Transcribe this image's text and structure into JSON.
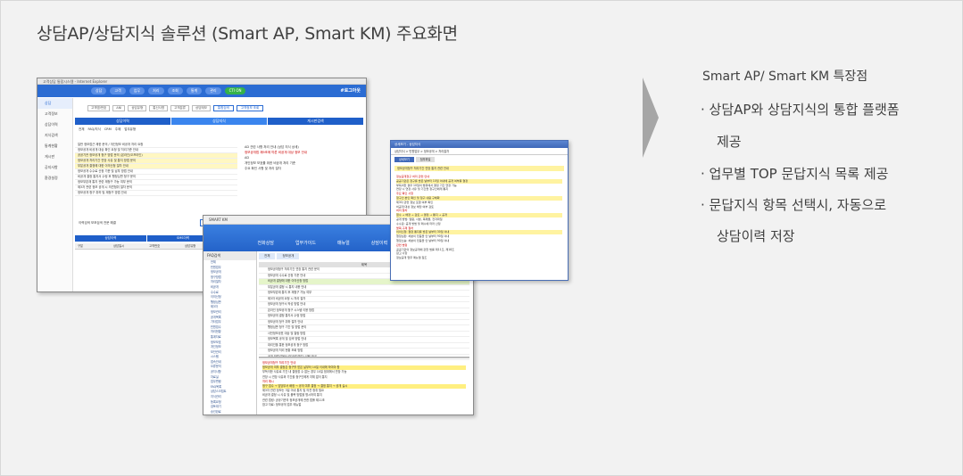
{
  "slide": {
    "title": "상담AP/상담지식 솔루션 (Smart AP, Smart KM) 주요화면"
  },
  "features": {
    "heading": "Smart AP/ Smart KM 특장점",
    "items": [
      {
        "line1": "· 상담AP와 상담지식의 통합 플랫폼",
        "line2": "제공"
      },
      {
        "line1": "· 업무별 TOP 문답지식 목록 제공",
        "line2": ""
      },
      {
        "line1": "· 문답지식 항목 선택시, 자동으로",
        "line2": "상담이력 저장"
      }
    ]
  },
  "colors": {
    "background": "#f2f2f2",
    "text": "#404040",
    "accent_blue": "#2b6cd3",
    "chevron": "#a6a6a6"
  },
  "screen_ap": {
    "window_title": "고객상담 통합시스템 - Internet Explorer",
    "nav_pills": [
      "상담",
      "고객",
      "업무",
      "처리",
      "조회",
      "통계",
      "관리"
    ],
    "nav_active": "CTI ON",
    "logo": "#로그아웃",
    "side_menu": [
      "상담",
      "고객정보",
      "상담이력",
      "지식검색",
      "통계현황",
      "게시판",
      "공지사항",
      "환경설정"
    ],
    "toolbar_boxes": [
      "고객명/번호",
      "ANI",
      "상담유형",
      "통신사명",
      "고객분류",
      "상담메모"
    ],
    "toolbar_buttons": [
      "통합검색",
      "고객정보 조회"
    ],
    "tabs": [
      "상담이력",
      "상담지식",
      "게시판검색"
    ],
    "sub_tabs": [
      "전체",
      "FAQ/지식",
      "CRM",
      "주제",
      "업무유형"
    ],
    "rows": [
      "일반 정보접근 제한 문의 / 개인정보 비공개 처리 요청",
      "정보공개 비공개 대상 확인 요청 및 처리기준 안내",
      "공공기관 정보공개 청구 방법 문의 (온라인/오프라인)",
      "정보공개 처리기간 연장 사유 및 통지 방법 문의",
      "부분공개 결정에 대한 이의신청 절차 안내",
      "정보공개 수수료 산정 기준 및 납부 방법 안내",
      "비공개 결정 통지서 수령 후 행정심판 청구 문의",
      "정보부존재 통지 관련 재청구 가능 여부 문의",
      "제3자 관련 정보 공개 시 의견청취 절차 문의",
      "정보공개 청구 취하 및 재청구 방법 안내"
    ],
    "right_lines": [
      "AD 관련 사항 처리 안내 (상담 지식 상세)",
      "정보공개법 제9조에 따른 비공개 대상 정보 안내",
      "AD",
      "개인정보 보호를 위한 비공개 처리 기준",
      "주요 확인 사항 및 처리 절차"
    ],
    "label": "이력검색 보조검색 전문 해결",
    "buttons": [
      "상담저장",
      "이관",
      "상담이력 조회",
      "고객정보 수정",
      "SMS 발송",
      "메모 저장"
    ],
    "bottom_tabs": [
      "상담이력",
      "SMS이력",
      "콜백이력",
      "예약이력"
    ],
    "grid_headers": [
      "구분",
      "상담일시",
      "고객번호",
      "상담유형",
      "처리자",
      "처리결과"
    ]
  },
  "screen_km": {
    "window_title": "SMART KM",
    "menu": [
      "전화상담",
      "업무가이드",
      "매뉴얼",
      "상담이력",
      "CRM"
    ],
    "left_header": "FAQ검색",
    "tree": [
      "전체",
      "민원업무",
      "정보공개",
      "청구방법",
      "처리절차",
      "비공개",
      "수수료",
      "이의신청",
      "행정심판",
      "제3자",
      "정보관리",
      "공개목록",
      "기타업무",
      "민원접수",
      "처리현황",
      "통계자료",
      "정보보호",
      "개인정보",
      "보안관리",
      "시스템",
      "접속안내",
      "오류문의",
      "공지사항",
      "자료실",
      "업무편람",
      "FAQ목록",
      "상담스크립트",
      "지식관리",
      "등록요청",
      "검토대기",
      "승인완료",
      "폐기목록",
      "관리자",
      "권한설정",
      "코드관리",
      "로그조회"
    ],
    "tabs": [
      "전체",
      "정보공개"
    ],
    "list_header": "제목",
    "rows": [
      "정보공개청구 처리기간 연장 통지 관련 문의",
      "정보공개 수수료 산정 기준 안내",
      "비공개 결정에 대한 이의신청 방법",
      "부분공개 결정 시 통지 내용 안내",
      "정보부존재 통지 후 재청구 가능 여부",
      "제3자 비공개 요청 시 처리 절차",
      "정보공개 청구서 작성 방법 안내",
      "온라인 정보공개 청구 시스템 이용 방법",
      "정보공개 결정 통지서 수령 방법",
      "정보공개 청구 취하 절차 안내",
      "행정심판 청구 기간 및 방법 문의",
      "사전정보공표 대상 및 열람 방법",
      "정보목록 공개 및 검색 방법 안내",
      "대리인을 통한 정보공개 청구 방법",
      "정보공개 처리 현황 조회 방법",
      "공개 방법(열람/사본/전자파일) 선택 안내"
    ],
    "detail_lines": [
      "정보공개청구 처리기간 안내",
      "정보공개 여부 결정은 청구를 받은 날부터 10일 이내에 하여야 함",
      "부득이한 사유로 기간 내 결정할 수 없는 경우 10일 범위에서 연장 가능",
      "연장 시 연장 사유와 기간을 청구인에게 지체 없이 통지",
      "처리 예시",
      "청구 접수 → 담당부서 배정 → 공개 여부 결정 → 결정 통지 → 공개 실시",
      "제3자 관련 정보는 3일 이내 통지 및 의견 청취 필요",
      "비공개 결정 시 사유 및 불복 방법을 명시하여 통지",
      "관련 법령: 공공기관의 정보공개에 관한 법률 제11조",
      "참고 자료: 정보공개 업무 매뉴얼"
    ]
  },
  "screen_detail": {
    "window_title": "상세보기 - 상담지식",
    "path": "상담지식 > 민원업무 > 정보공개 > 처리절차",
    "tabs": [
      "상세보기",
      "첨부파일"
    ],
    "bar": "정보공개청구 처리기간 연장 통지 관련 안내",
    "lines": [
      "정보공개청구 처리 관련 안내",
      "공공기관은 청구를 받은 날부터 10일 이내에 공개 여부를 결정",
      "부득이한 경우 10일의 범위에서 결정 기간 연장 가능",
      "연장 시 연장 사유 및 기간을 청구인에게 통지",
      "주요 확인 사항",
      "청구인 본인 확인 및 청구 내용 구체화",
      "제3자 관련 정보 포함 여부 확인",
      "비공개 대상 정보 해당 여부 검토",
      "처리 절차",
      "접수 → 배정 → 검토 → 결정 → 통지 → 공개",
      "공개 방법: 열람, 사본, 복제물, 전자파일",
      "수수료: 공개 방법 및 매수에 따라 산정",
      "불복 구제 절차",
      "이의신청: 결정 통지를 받은 날부터 30일 이내",
      "행정심판: 처분이 있음을 안 날부터 90일 이내",
      "행정소송: 처분이 있음을 안 날부터 90일 이내",
      "관련 법령",
      "공공기관의 정보공개에 관한 법률 제11조, 제18조",
      "참고 사항",
      "정보공개 업무 매뉴얼 참조"
    ]
  }
}
